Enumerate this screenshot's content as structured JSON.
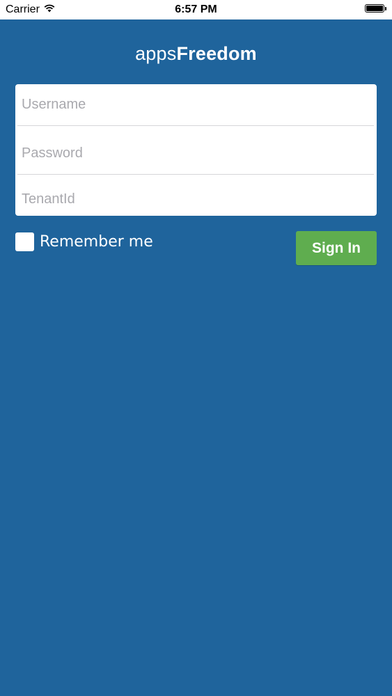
{
  "status_bar": {
    "carrier": "Carrier",
    "time": "6:57 PM",
    "battery_level": 1.0
  },
  "header": {
    "title_light": "apps",
    "title_bold": "Freedom"
  },
  "form": {
    "username": {
      "placeholder": "Username",
      "value": ""
    },
    "password": {
      "placeholder": "Password",
      "value": ""
    },
    "tenant": {
      "placeholder": "TenantId",
      "value": ""
    }
  },
  "remember": {
    "label": "Remember me",
    "checked": false
  },
  "actions": {
    "sign_in_label": "Sign In"
  },
  "colors": {
    "background": "#1f649c",
    "button": "#5fad4f"
  }
}
